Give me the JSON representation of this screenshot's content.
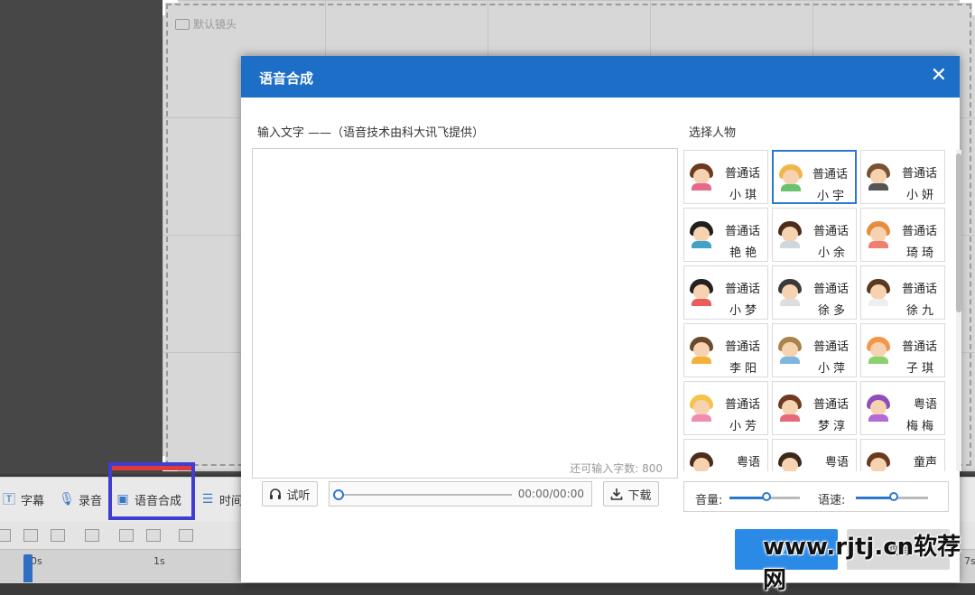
{
  "preview": {
    "lens_label": "默认镜头"
  },
  "toolbar": {
    "subtitle": "字幕",
    "record": "录音",
    "tts": "语音合成",
    "time": "时间"
  },
  "ruler": {
    "tick0": "0s",
    "tick1": "1s",
    "tick_end": "7s"
  },
  "dialog": {
    "title": "语音合成",
    "close": "✕",
    "input_label": "输入文字 ——（语音技术由科大讯飞提供）",
    "remaining": "还可输入字数: 800",
    "listen": "试听",
    "time": "00:00/00:00",
    "download": "下载",
    "voice_label": "选择人物",
    "volume_label": "音量:",
    "speed_label": "语速:",
    "volume_value": 0.52,
    "speed_value": 0.52,
    "apply": "应用",
    "cancel": "取消"
  },
  "voices": [
    {
      "line1": "普通话",
      "line2": "小琪",
      "hair": "#6b3a1e",
      "body": "#e86a8a",
      "selected": false
    },
    {
      "line1": "普通话",
      "line2": "小宇",
      "hair": "#f1b64a",
      "body": "#6cc16d",
      "selected": true
    },
    {
      "line1": "普通话",
      "line2": "小妍",
      "hair": "#7a5232",
      "body": "#555555",
      "selected": false
    },
    {
      "line1": "普通话",
      "line2": "艳艳",
      "hair": "#1f1f1f",
      "body": "#3fa2c9",
      "selected": false
    },
    {
      "line1": "普通话",
      "line2": "小余",
      "hair": "#4a2d1a",
      "body": "#cfd8dc",
      "selected": false
    },
    {
      "line1": "普通话",
      "line2": "琦琦",
      "hair": "#e58d3d",
      "body": "#f07f6f",
      "selected": false
    },
    {
      "line1": "普通话",
      "line2": "小梦",
      "hair": "#222222",
      "body": "#e95d5d",
      "selected": false
    },
    {
      "line1": "普通话",
      "line2": "徐多",
      "hair": "#3a3a3a",
      "body": "#dddddd",
      "selected": false
    },
    {
      "line1": "普通话",
      "line2": "徐九",
      "hair": "#5a3a1f",
      "body": "#eeeeee",
      "selected": false
    },
    {
      "line1": "普通话",
      "line2": "李阳",
      "hair": "#6b4a2b",
      "body": "#f4b13c",
      "selected": false
    },
    {
      "line1": "普通话",
      "line2": "小萍",
      "hair": "#a9824d",
      "body": "#7db6e0",
      "selected": false
    },
    {
      "line1": "普通话",
      "line2": "子琪",
      "hair": "#f2964a",
      "body": "#8ad06b",
      "selected": false
    },
    {
      "line1": "普通话",
      "line2": "小芳",
      "hair": "#f6c34a",
      "body": "#f08cb0",
      "selected": false
    },
    {
      "line1": "普通话",
      "line2": "梦淳",
      "hair": "#6e3b21",
      "body": "#e56b7b",
      "selected": false
    },
    {
      "line1": "粤语",
      "line2": "梅梅",
      "hair": "#8e4fb8",
      "body": "#b46ad6",
      "selected": false
    },
    {
      "line1": "粤语",
      "line2": "",
      "hair": "#4a2d1a",
      "body": "#ffffff",
      "selected": false
    },
    {
      "line1": "粤语",
      "line2": "",
      "hair": "#3b2a1a",
      "body": "#ffffff",
      "selected": false
    },
    {
      "line1": "童声",
      "line2": "",
      "hair": "#6b3a1e",
      "body": "#ffffff",
      "selected": false
    }
  ],
  "watermark": "www.rjtj.cn软荐网",
  "colors": {
    "accent": "#1c6ec6",
    "apply": "#2b8ae6",
    "highlight": "#3f3ed0"
  }
}
